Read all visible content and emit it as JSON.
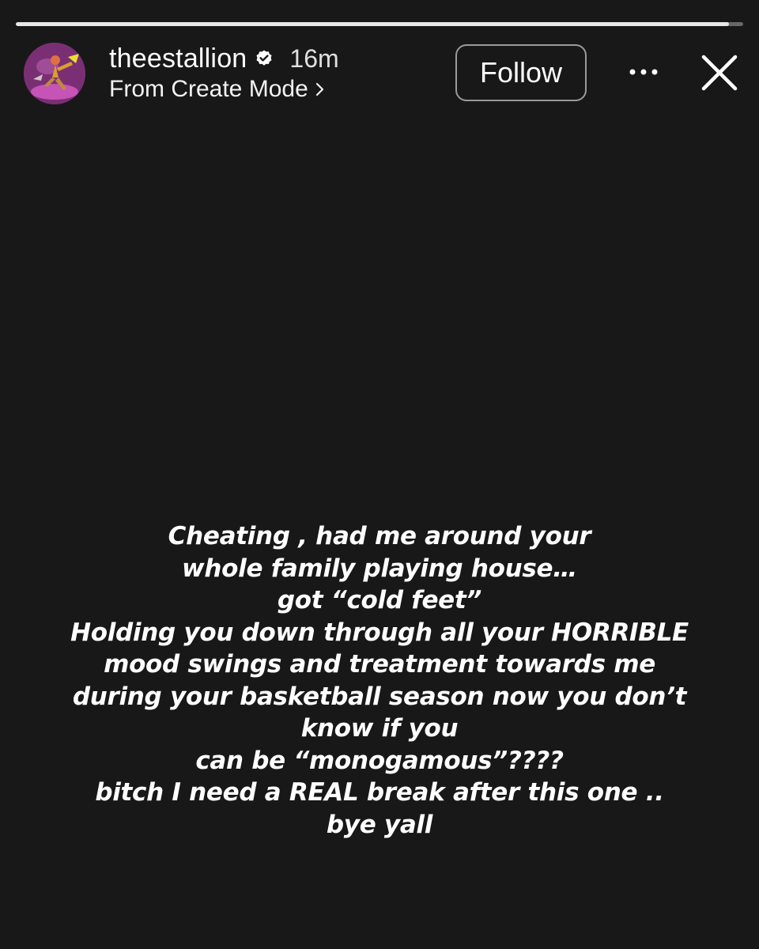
{
  "progress": {
    "fraction": 0.98,
    "fill_color": "#e8e8e8"
  },
  "header": {
    "username": "theestallion",
    "verified_icon": "verified-badge-icon",
    "time_ago": "16m",
    "subtitle": "From Create Mode",
    "subtitle_icon": "chevron-right-icon",
    "follow_label": "Follow",
    "more_icon": "more-dots-icon",
    "close_icon": "close-icon"
  },
  "story": {
    "background_color": "#181818",
    "caption_lines": [
      "Cheating , had me around your",
      "whole family playing house…",
      "got “cold feet”",
      "Holding you down through all your HORRIBLE",
      "mood swings and treatment towards me",
      "during your basketball season now you don’t",
      "know if you",
      "can be “monogamous”????",
      "bitch I need a REAL break after this one ..",
      "bye yall"
    ]
  }
}
